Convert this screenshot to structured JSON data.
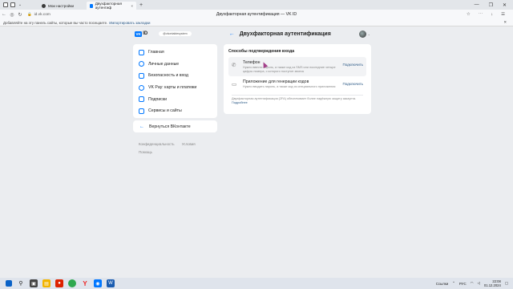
{
  "browser": {
    "tabs": [
      {
        "label": "Мои настройки"
      },
      {
        "label": "Двухфакторная аутентиф",
        "close": "×"
      }
    ],
    "new_tab": "+",
    "window_controls": [
      "—",
      "❐",
      "✕"
    ],
    "url_domain": "id.vk.com",
    "page_title": "Двухфакторная аутентификация — VK ID",
    "addr_right_icons": [
      "☆",
      "⋯",
      "↓",
      "☰"
    ]
  },
  "infobar": {
    "text": "Добавляйте на эту панель сайты, которые вы часто посещаете.",
    "link": "Импортировать закладки",
    "close": "✕"
  },
  "header": {
    "logo_vk": "VK",
    "logo_id": "ID",
    "account": "@vkontaktesystem",
    "back_arrow": "←",
    "title": "Двухфакторная аутентификация"
  },
  "sidebar": {
    "items": [
      {
        "label": "Главная",
        "icon": "home-icon"
      },
      {
        "label": "Личные данные",
        "icon": "user-icon"
      },
      {
        "label": "Безопасность и вход",
        "icon": "shield-icon"
      },
      {
        "label": "VK Pay: карты и платежи",
        "icon": "card-icon"
      },
      {
        "label": "Подписки",
        "icon": "subscriptions-icon"
      },
      {
        "label": "Сервисы и сайты",
        "icon": "services-icon"
      }
    ],
    "back_label": "Вернуться ВКонтакте",
    "footer_links": [
      "Конфиденциальность",
      "Условия",
      "Помощь"
    ]
  },
  "card": {
    "title": "Способы подтверждения входа",
    "methods": [
      {
        "name": "Телефон",
        "description": "Нужно ввести пароль, а также код из SMS или последние четыре цифры номера, с которого поступит звонок",
        "action": "Подключить",
        "icon": "phone-icon"
      },
      {
        "name": "Приложение для генерации кодов",
        "description": "Нужно вводить пароль, а также код из специального приложения",
        "action": "Подключить",
        "icon": "app-icon"
      }
    ],
    "note_text": "Двухфакторная аутентификация (2FA) обеспечивает более надёжную защиту аккаунта.",
    "note_link": "Подробнее"
  },
  "taskbar": {
    "lang": "РУС",
    "locale": "Ссылки",
    "time": "22:08",
    "date": "01.12.2024"
  },
  "colors": {
    "accent": "#0077ff",
    "link": "#2a5885",
    "background": "#ebedf0"
  }
}
